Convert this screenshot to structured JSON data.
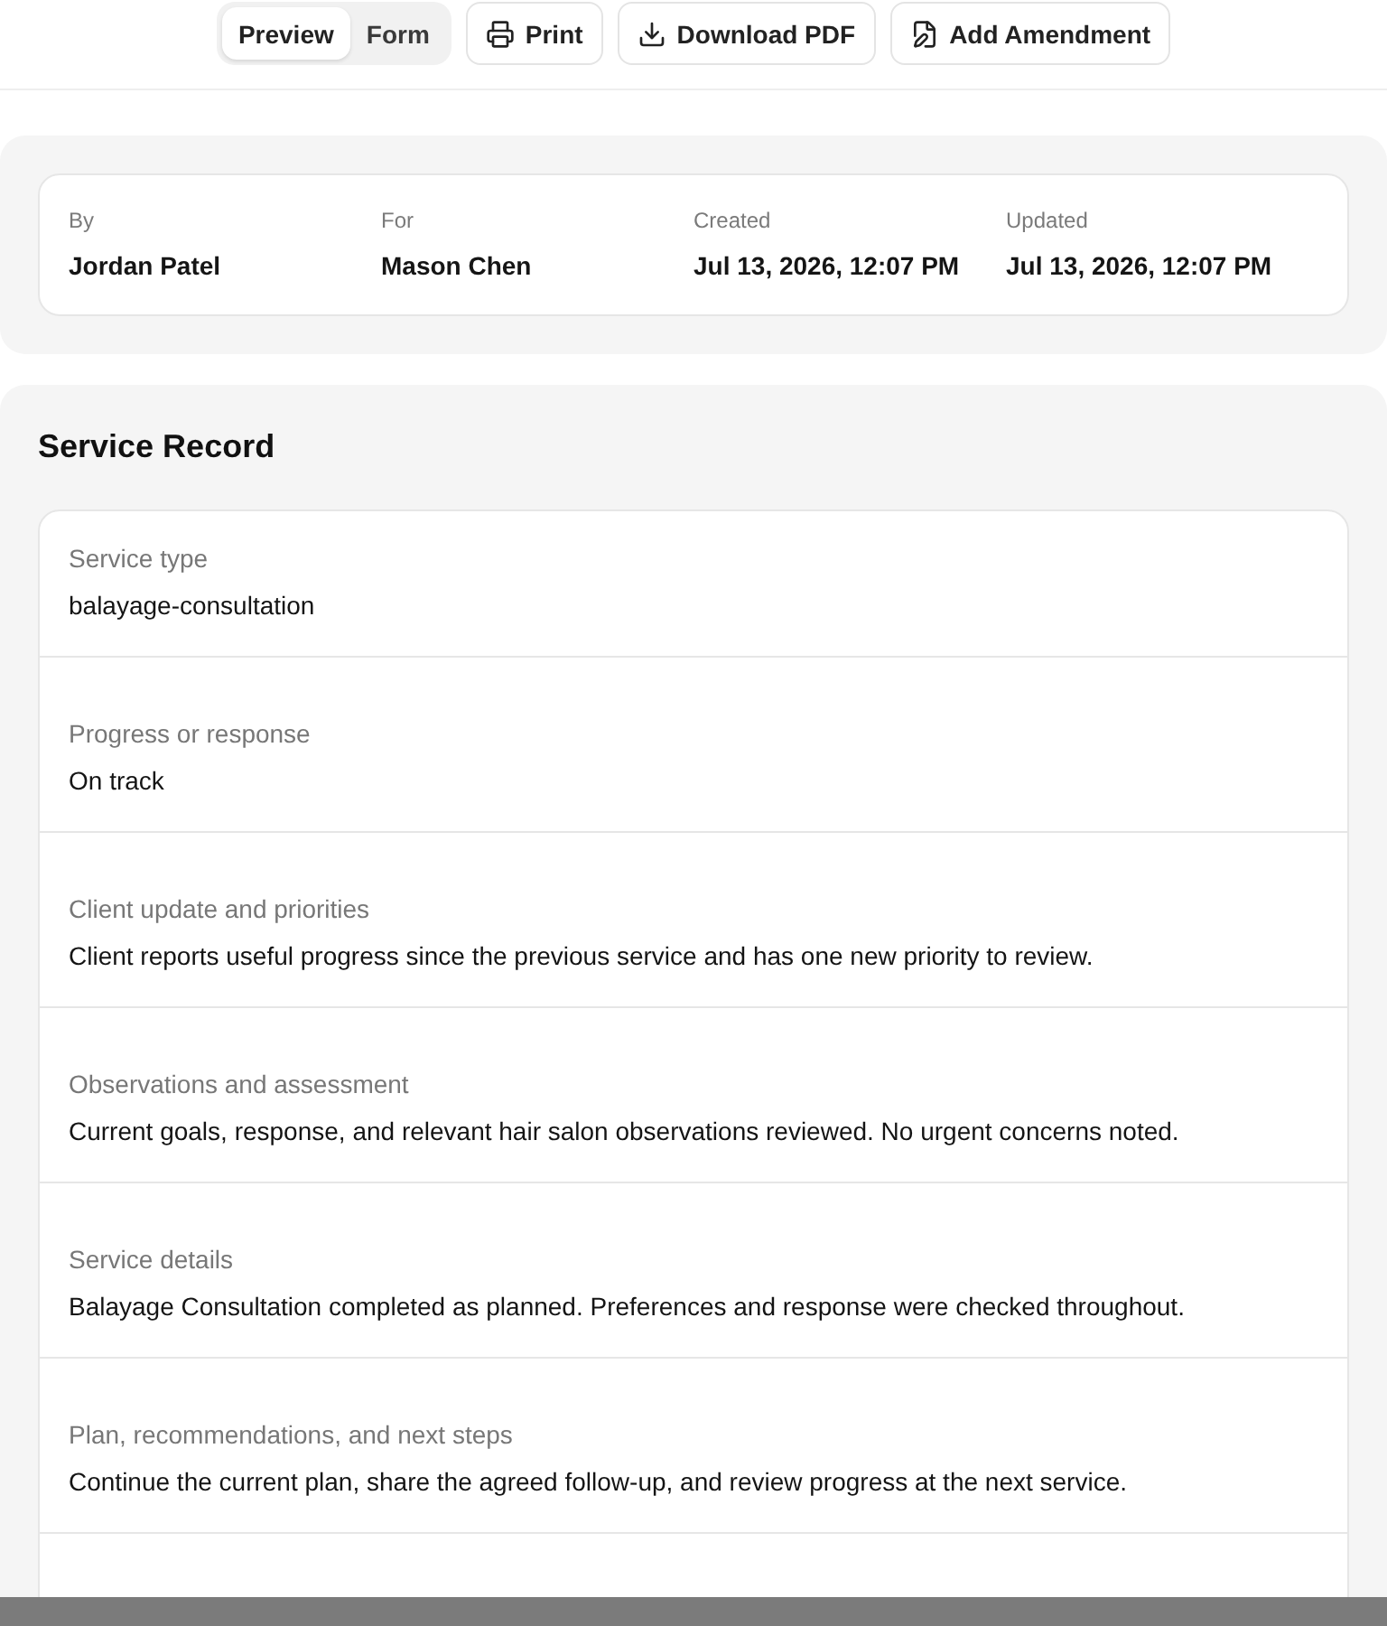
{
  "toolbar": {
    "view_tabs": [
      {
        "label": "Preview",
        "selected": true
      },
      {
        "label": "Form",
        "selected": false
      }
    ],
    "buttons": [
      {
        "label": "Print",
        "kind": "print"
      },
      {
        "label": "Download PDF",
        "kind": "download"
      },
      {
        "label": "Add Amendment",
        "kind": "amend"
      }
    ]
  },
  "meta": [
    {
      "label": "By",
      "value": "Jordan Patel"
    },
    {
      "label": "For",
      "value": "Mason Chen"
    },
    {
      "label": "Created",
      "value": "Jul 13, 2026, 12:07 PM"
    },
    {
      "label": "Updated",
      "value": "Jul 13, 2026, 12:07 PM"
    }
  ],
  "record": {
    "title": "Service Record",
    "fields": [
      {
        "label": "Service type",
        "value": "balayage-consultation"
      },
      {
        "label": "Progress or response",
        "value": "On track"
      },
      {
        "label": "Client update and priorities",
        "value": "Client reports useful progress since the previous service and has one new priority to review."
      },
      {
        "label": "Observations and assessment",
        "value": "Current goals, response, and relevant hair salon observations reviewed. No urgent concerns noted."
      },
      {
        "label": "Service details",
        "value": "Balayage Consultation completed as planned. Preferences and response were checked throughout."
      },
      {
        "label": "Plan, recommendations, and next steps",
        "value": "Continue the current plan, share the agreed follow-up, and review progress at the next service."
      }
    ]
  }
}
